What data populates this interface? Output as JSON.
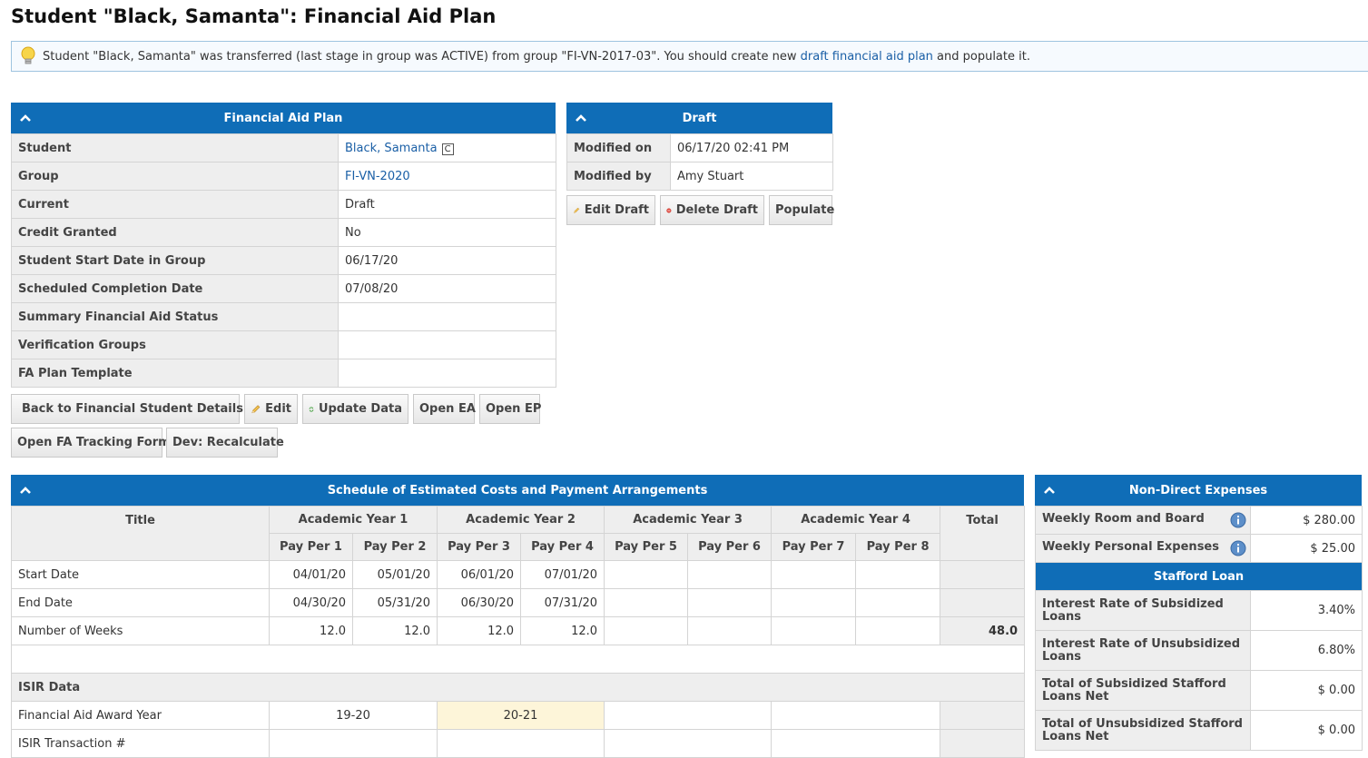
{
  "page": {
    "title": "Student \"Black, Samanta\": Financial Aid Plan"
  },
  "notice": {
    "text_before": "Student \"Black, Samanta\" was transferred (last stage in group was ACTIVE) from group \"FI-VN-2017-03\". You should create new ",
    "link": "draft financial aid plan",
    "text_after": " and populate it."
  },
  "fa_plan": {
    "header": "Financial Aid Plan",
    "rows": [
      {
        "label": "Student",
        "value": "Black, Samanta",
        "badge": "C",
        "link": true
      },
      {
        "label": "Group",
        "value": "FI-VN-2020",
        "link": true
      },
      {
        "label": "Current",
        "value": "Draft"
      },
      {
        "label": "Credit Granted",
        "value": "No"
      },
      {
        "label": "Student Start Date in Group",
        "value": "06/17/20"
      },
      {
        "label": "Scheduled Completion Date",
        "value": "07/08/20"
      },
      {
        "label": "Summary Financial Aid Status",
        "value": ""
      },
      {
        "label": "Verification Groups",
        "value": ""
      },
      {
        "label": "FA Plan Template",
        "value": ""
      }
    ]
  },
  "draft": {
    "header": "Draft",
    "modified_on_label": "Modified on",
    "modified_on": "06/17/20 02:41 PM",
    "modified_by_label": "Modified by",
    "modified_by": "Amy Stuart"
  },
  "buttons": {
    "edit_draft": "Edit Draft",
    "delete_draft": "Delete Draft",
    "populate": "Populate",
    "back": "Back to Financial Student Details",
    "edit": "Edit",
    "update_data": "Update Data",
    "open_ea": "Open EA",
    "open_ep": "Open EP",
    "open_fa_tracking": "Open FA Tracking Form",
    "dev_recalculate": "Dev: Recalculate"
  },
  "schedule": {
    "header": "Schedule of Estimated Costs and Payment Arrangements",
    "title_col": "Title",
    "total_col": "Total",
    "years": [
      "Academic Year 1",
      "Academic Year 2",
      "Academic Year 3",
      "Academic Year 4"
    ],
    "periods": [
      "Pay Per 1",
      "Pay Per 2",
      "Pay Per 3",
      "Pay Per 4",
      "Pay Per 5",
      "Pay Per 6",
      "Pay Per 7",
      "Pay Per 8"
    ],
    "rows": [
      {
        "label": "Start Date",
        "values": [
          "04/01/20",
          "05/01/20",
          "06/01/20",
          "07/01/20",
          "",
          "",
          "",
          ""
        ],
        "total": ""
      },
      {
        "label": "End Date",
        "values": [
          "04/30/20",
          "05/31/20",
          "06/30/20",
          "07/31/20",
          "",
          "",
          "",
          ""
        ],
        "total": ""
      },
      {
        "label": "Number of Weeks",
        "values": [
          "12.0",
          "12.0",
          "12.0",
          "12.0",
          "",
          "",
          "",
          ""
        ],
        "total": "48.0"
      }
    ],
    "isir_section": "ISIR Data",
    "isir_rows": [
      {
        "label": "Financial Aid Award Year",
        "values": [
          "19-20",
          "20-21",
          "",
          ""
        ]
      },
      {
        "label": "ISIR Transaction #",
        "values": [
          "",
          "",
          "",
          ""
        ]
      }
    ]
  },
  "non_direct": {
    "header": "Non-Direct Expenses",
    "rows": [
      {
        "label": "Weekly Room and Board",
        "value": "$ 280.00"
      },
      {
        "label": "Weekly Personal Expenses",
        "value": "$ 25.00"
      }
    ],
    "stafford_header": "Stafford Loan",
    "stafford_rows": [
      {
        "label": "Interest Rate of Subsidized Loans",
        "value": "3.40%"
      },
      {
        "label": "Interest Rate of Unsubsidized Loans",
        "value": "6.80%"
      },
      {
        "label": "Total of Subsidized Stafford Loans Net",
        "value": "$ 0.00"
      },
      {
        "label": "Total of Unsubsidized Stafford Loans Net",
        "value": "$ 0.00"
      }
    ]
  },
  "icons": {
    "notice": "lightbulb-icon",
    "collapse": "chevron-up-icon",
    "info": "info-icon",
    "edit": "pencil-icon",
    "delete": "delete-icon",
    "back": "back-arrow-icon",
    "update": "refresh-icon",
    "copy": "copy-badge-icon"
  }
}
